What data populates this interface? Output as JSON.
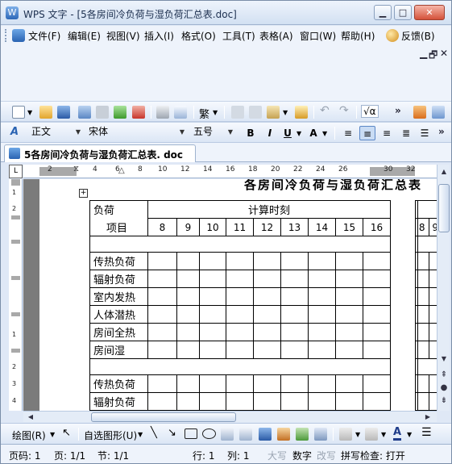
{
  "window": {
    "title": "WPS 文字 - [5各房间冷负荷与湿负荷汇总表.doc]",
    "controls": {
      "minimize": "▁",
      "maximize": "□",
      "close": "✕"
    }
  },
  "menu": {
    "items": [
      {
        "label": "文件(F)"
      },
      {
        "label": "编辑(E)"
      },
      {
        "label": "视图(V)"
      },
      {
        "label": "插入(I)"
      },
      {
        "label": "格式(O)"
      },
      {
        "label": "工具(T)"
      },
      {
        "label": "表格(A)"
      },
      {
        "label": "窗口(W)"
      },
      {
        "label": "帮助(H)"
      }
    ],
    "feedback": "反馈(B)",
    "mdi": {
      "minimize": "▁",
      "restore": "🗗",
      "close": "✕"
    }
  },
  "standard_toolbar": {
    "traditional_label": "繁",
    "formula_label": "√α",
    "more": "»"
  },
  "format_toolbar": {
    "style_value": "正文",
    "font_value": "宋体",
    "size_value": "五号",
    "bold": "B",
    "italic": "I",
    "underline": "U",
    "font_color": "A",
    "more": "»"
  },
  "doc_tab": {
    "label": "5各房间冷负荷与湿负荷汇总表. doc",
    "close": "×"
  },
  "ruler": {
    "h_numbers": [
      "2",
      "2",
      "4",
      "6",
      "8",
      "10",
      "12",
      "14",
      "16",
      "18",
      "20",
      "22",
      "24",
      "26",
      "28",
      "30",
      "32"
    ],
    "v_numbers": [
      "1",
      "2",
      "1",
      "2",
      "3",
      "4",
      "5",
      "6",
      "7",
      "8",
      "1",
      "2",
      "3",
      "4"
    ]
  },
  "document": {
    "title": "各房间冷负荷与湿负荷汇总表",
    "table": {
      "header_top": "负荷",
      "header_bottom": "项目",
      "header_time": "计算时刻",
      "hours": [
        "8",
        "9",
        "10",
        "11",
        "12",
        "13",
        "14",
        "15",
        "16"
      ],
      "rows_group1": [
        "传热负荷",
        "辐射负荷",
        "室内发热",
        "人体潜热",
        "房间全热",
        "房间湿"
      ],
      "rows_group2": [
        "传热负荷",
        "辐射负荷"
      ]
    },
    "table2_hours": [
      "8",
      "9"
    ]
  },
  "drawing_toolbar": {
    "draw_label": "绘图(R)",
    "autoshape_label": "自选图形(U)"
  },
  "status": {
    "page_no": "页码: 1",
    "page": "页: 1/1",
    "section": "节: 1/1",
    "line": "行: 1",
    "column": "列: 1",
    "caps": "大写",
    "num": "数字",
    "overwrite": "改写",
    "spell_check": "拼写检查: 打开"
  },
  "colors": {
    "accent": "#2a63b2",
    "page_gutter": "#7b7b7b",
    "toolbar_bg": "#dbe6f5"
  }
}
